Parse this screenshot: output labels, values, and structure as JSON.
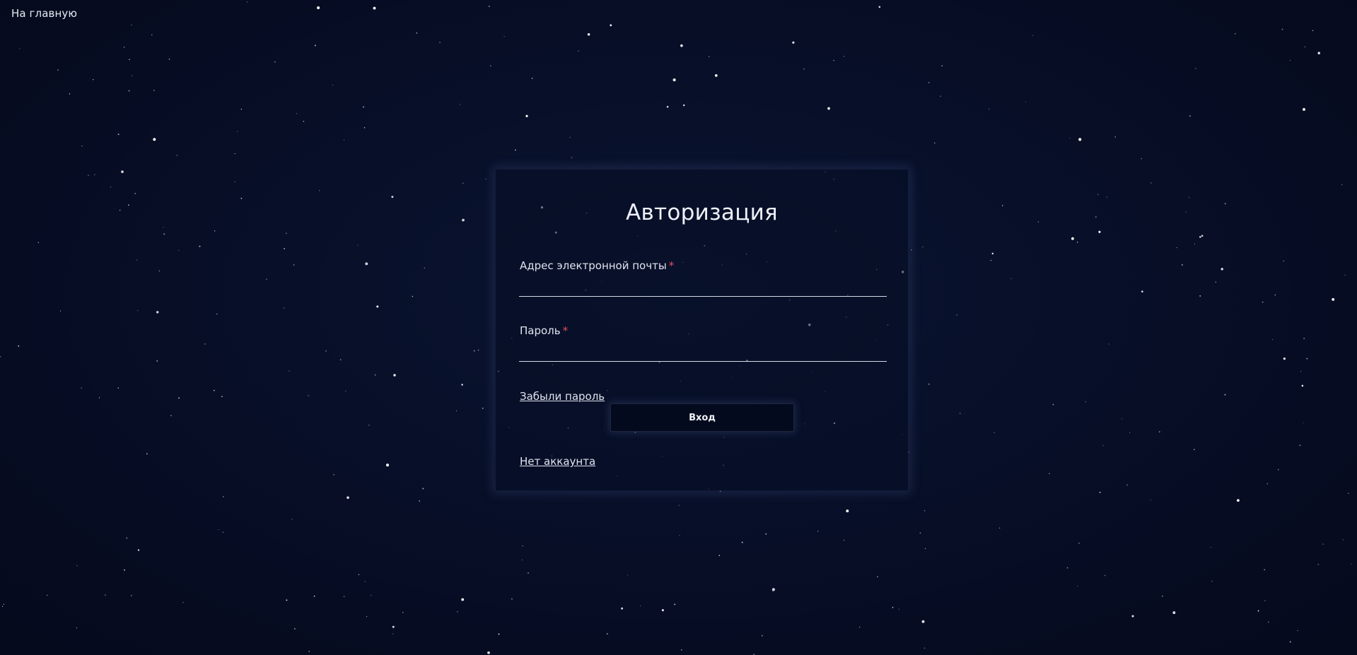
{
  "nav": {
    "home_label": "На главную"
  },
  "login_form": {
    "title": "Авторизация",
    "email": {
      "label": "Адрес электронной почты",
      "required_mark": "*",
      "value": "",
      "placeholder": ""
    },
    "password": {
      "label": "Пароль",
      "required_mark": "*",
      "value": "",
      "placeholder": ""
    },
    "forgot_password_label": "Забыли пароль",
    "submit_label": "Вход",
    "no_account_label": "Нет аккаунта"
  },
  "theme": {
    "background": "#060c22",
    "card_background": "#070e26",
    "text_color": "#e8ecf5",
    "required_color": "#e0505a",
    "star_color": "#ffffff"
  }
}
